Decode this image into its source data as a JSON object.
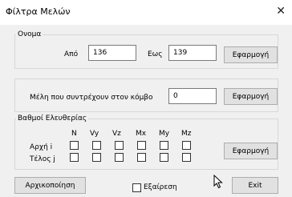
{
  "window": {
    "title": "Φίλτρα Μελών",
    "close_symbol": "✕"
  },
  "name_group": {
    "legend": "Ονομα",
    "from_label": "Από",
    "from_value": "136",
    "to_label": "Εως",
    "to_value": "139",
    "apply_label": "Εφαρμογή"
  },
  "node_group": {
    "label": "Μέλη που συντρέχουν στον κόμβο",
    "value": "0",
    "apply_label": "Εφαρμογή"
  },
  "dof_group": {
    "legend": "Βαθμοί Ελευθερίας",
    "columns": [
      "N",
      "Vy",
      "Vz",
      "Mx",
      "My",
      "Mz"
    ],
    "start_label": "Αρχή i",
    "end_label": "Τέλος j",
    "apply_label": "Εφαρμογή"
  },
  "footer": {
    "reset_label": "Αρχικοποίηση",
    "exclude_label": "Εξαίρεση",
    "exit_label": "Exit"
  }
}
